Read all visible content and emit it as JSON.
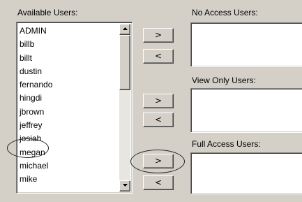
{
  "available_users": {
    "label": "Available Users:",
    "items": [
      "ADMIN",
      "billb",
      "billt",
      "dustin",
      "fernando",
      "hingdi",
      "jbrown",
      "jeffrey",
      "josiah",
      "megan",
      "michael",
      "mike"
    ]
  },
  "no_access": {
    "label": "No Access Users:",
    "add_label": ">",
    "remove_label": "<"
  },
  "view_only": {
    "label": "View Only Users:",
    "add_label": ">",
    "remove_label": "<"
  },
  "full_access": {
    "label": "Full Access Users:",
    "add_label": ">",
    "remove_label": "<"
  },
  "colors": {
    "window_bg": "#d4d0c8",
    "list_bg": "#ffffff",
    "annotation": "#222222"
  },
  "annotations": {
    "circled_item": "josiah",
    "circled_button": "full_access.add"
  }
}
